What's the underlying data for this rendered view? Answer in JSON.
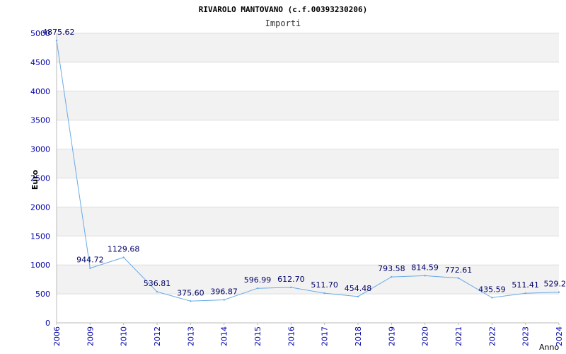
{
  "chart_data": {
    "type": "line",
    "title": "RIVAROLO MANTOVANO (c.f.00393230206)",
    "subtitle": "Importi",
    "xlabel": "Anno",
    "ylabel": "Euro",
    "ylim": [
      0,
      5000
    ],
    "yticks": [
      "0",
      "500",
      "1000",
      "1500",
      "2000",
      "2500",
      "3000",
      "3500",
      "4000",
      "4500",
      "5000"
    ],
    "categories": [
      "2006",
      "2009",
      "2010",
      "2012",
      "2013",
      "2014",
      "2015",
      "2016",
      "2017",
      "2018",
      "2019",
      "2020",
      "2021",
      "2022",
      "2023",
      "2024"
    ],
    "values": [
      4875.62,
      944.72,
      1129.68,
      536.81,
      375.6,
      396.87,
      596.99,
      612.7,
      511.7,
      454.48,
      793.58,
      814.59,
      772.61,
      435.59,
      511.41,
      529.2
    ],
    "labels": [
      "4875.62",
      "944.72",
      "1129.68",
      "536.81",
      "375.60",
      "396.87",
      "596.99",
      "612.70",
      "511.70",
      "454.48",
      "793.58",
      "814.59",
      "772.61",
      "435.59",
      "511.41",
      "529.2"
    ],
    "grid": true,
    "colors": {
      "line": "#6aaae6",
      "tick_text": "#0000aa",
      "label_text": "#000066",
      "title_text": "#000000",
      "band": "#f2f2f2",
      "grid": "#dddddd",
      "axis": "#bbbbbb"
    }
  }
}
